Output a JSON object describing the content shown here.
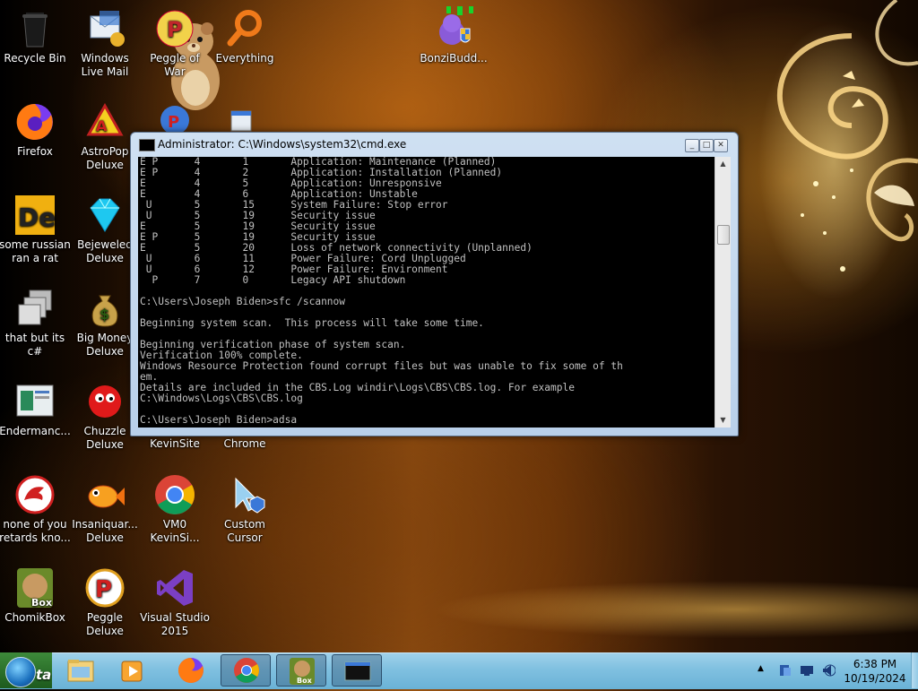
{
  "desktop": {
    "icons": [
      {
        "id": "recycle-bin",
        "label": "Recycle Bin"
      },
      {
        "id": "windows-live-mail",
        "label": "Windows Live Mail"
      },
      {
        "id": "peggle-of-war",
        "label": "Peggle of War"
      },
      {
        "id": "everything",
        "label": "Everything"
      },
      {
        "id": "bonzibuddy",
        "label": "BonziBudd..."
      },
      {
        "id": "firefox",
        "label": "Firefox"
      },
      {
        "id": "astropop",
        "label": "AstroPop Deluxe"
      },
      {
        "id": "some-russian",
        "label": "some russian ran a rat"
      },
      {
        "id": "bejeweled",
        "label": "Bejeweled Deluxe"
      },
      {
        "id": "that-but-csharp",
        "label": "that but its c#"
      },
      {
        "id": "big-money",
        "label": "Big Money Deluxe"
      },
      {
        "id": "endermanch",
        "label": "Endermanc..."
      },
      {
        "id": "chuzzle",
        "label": "Chuzzle Deluxe"
      },
      {
        "id": "kevinsite",
        "label": "KevinSite"
      },
      {
        "id": "chrome",
        "label": "Chrome"
      },
      {
        "id": "none-of-you",
        "label": "none of you retards kno..."
      },
      {
        "id": "insaniquarium",
        "label": "Insaniquar... Deluxe"
      },
      {
        "id": "vm0-kevinsite",
        "label": "VM0 KevinSi..."
      },
      {
        "id": "custom-cursor",
        "label": "Custom Cursor"
      },
      {
        "id": "chomikbox",
        "label": "ChomikBox"
      },
      {
        "id": "peggle-deluxe",
        "label": "Peggle Deluxe"
      },
      {
        "id": "visual-studio",
        "label": "Visual Studio 2015"
      }
    ]
  },
  "cmd_window": {
    "title": "Administrator: C:\\Windows\\system32\\cmd.exe",
    "console_text": "E P      4       1       Application: Maintenance (Planned)\nE P      4       2       Application: Installation (Planned)\nE        4       5       Application: Unresponsive\nE        4       6       Application: Unstable\n U       5       15      System Failure: Stop error\n U       5       19      Security issue\nE        5       19      Security issue\nE P      5       19      Security issue\nE        5       20      Loss of network connectivity (Unplanned)\n U       6       11      Power Failure: Cord Unplugged\n U       6       12      Power Failure: Environment\n  P      7       0       Legacy API shutdown\n\nC:\\Users\\Joseph Biden>sfc /scannow\n\nBeginning system scan.  This process will take some time.\n\nBeginning verification phase of system scan.\nVerification 100% complete.\nWindows Resource Protection found corrupt files but was unable to fix some of th\nem.\nDetails are included in the CBS.Log windir\\Logs\\CBS\\CBS.log. For example\nC:\\Windows\\Logs\\CBS\\CBS.log\n\nC:\\Users\\Joseph Biden>adsa"
  },
  "taskbar": {
    "start_label": "ta",
    "clock_time": "6:38 PM",
    "clock_date": "10/19/2024"
  }
}
